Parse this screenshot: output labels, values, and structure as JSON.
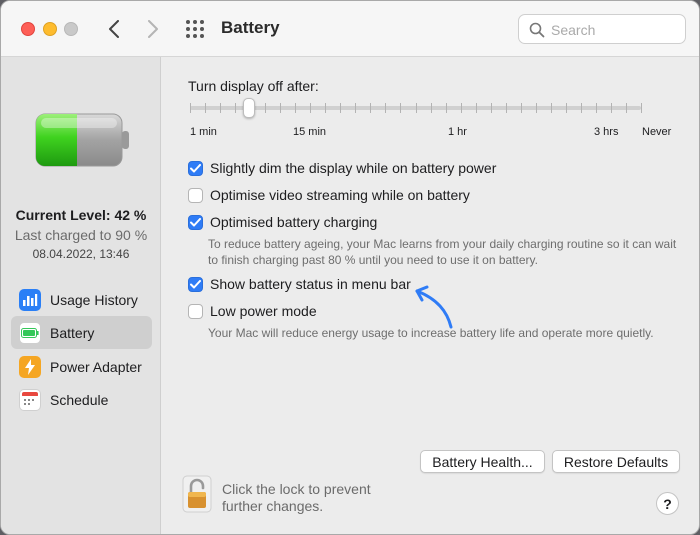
{
  "window": {
    "title": "Battery"
  },
  "search": {
    "placeholder": "Search"
  },
  "sidebar": {
    "current_level": "Current Level: 42 %",
    "last_charged": "Last charged to 90 %",
    "charged_date": "08.04.2022, 13:46",
    "items": [
      {
        "label": "Usage History",
        "icon": "bar-chart-icon",
        "color": "#2a7ff6"
      },
      {
        "label": "Battery",
        "icon": "battery-icon",
        "color": "#34c759",
        "selected": true
      },
      {
        "label": "Power Adapter",
        "icon": "lightning-icon",
        "color": "#f5a623"
      },
      {
        "label": "Schedule",
        "icon": "calendar-icon",
        "color": "#e8483f"
      }
    ]
  },
  "display_slider": {
    "title": "Turn display off after:",
    "labels": [
      "1 min",
      "15 min",
      "1 hr",
      "3 hrs",
      "Never"
    ],
    "selected": "2 min"
  },
  "options": [
    {
      "label": "Slightly dim the display while on battery power",
      "checked": true
    },
    {
      "label": "Optimise video streaming while on battery",
      "checked": false
    },
    {
      "label": "Optimised battery charging",
      "checked": true,
      "help": "To reduce battery ageing, your Mac learns from your daily charging routine so it can wait to finish charging past 80 % until you need to use it on battery."
    },
    {
      "label": "Show battery status in menu bar",
      "checked": true
    },
    {
      "label": "Low power mode",
      "checked": false,
      "help": "Your Mac will reduce energy usage to increase battery life and operate more quietly."
    }
  ],
  "buttons": {
    "battery_health": "Battery Health...",
    "restore_defaults": "Restore Defaults",
    "help": "?"
  },
  "lock": {
    "text": "Click the lock to prevent further changes."
  },
  "colors": {
    "accent": "#2f7cf6",
    "battery_green": "#34c759"
  }
}
